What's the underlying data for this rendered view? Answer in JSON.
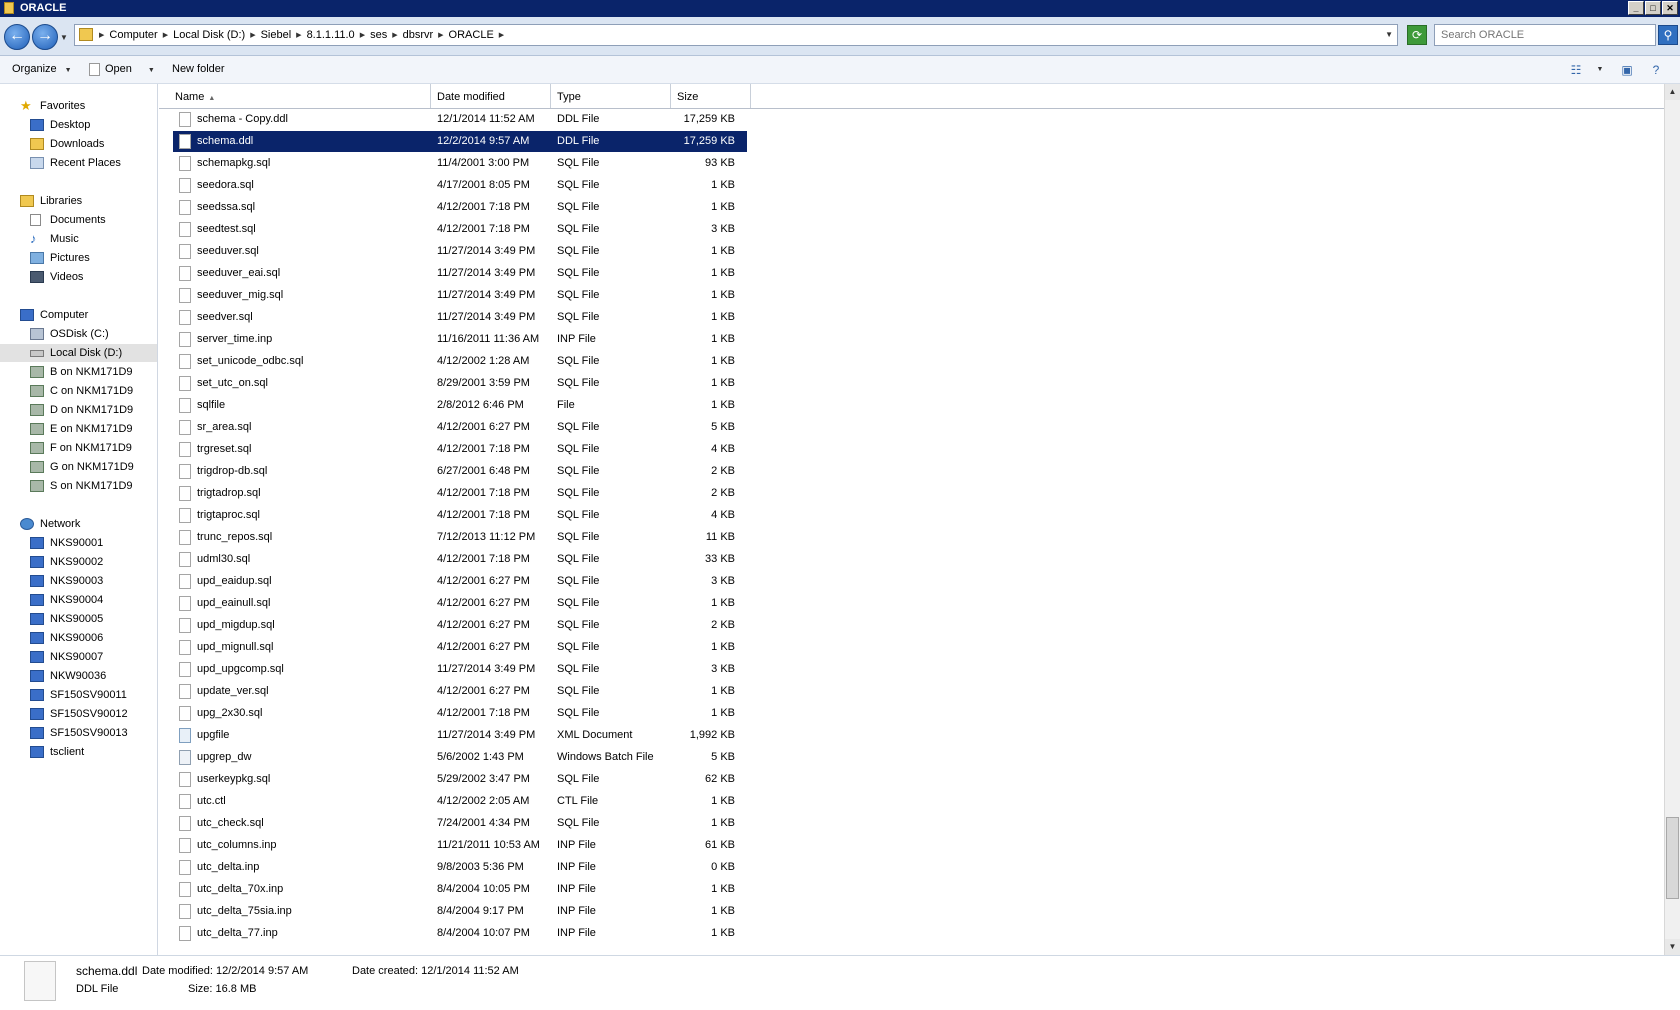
{
  "window": {
    "title": "ORACLE"
  },
  "address": {
    "crumbs": [
      "Computer",
      "Local Disk (D:)",
      "Siebel",
      "8.1.1.11.0",
      "ses",
      "dbsrvr",
      "ORACLE"
    ],
    "search_placeholder": "Search ORACLE"
  },
  "toolbar": {
    "organize": "Organize",
    "open": "Open",
    "new_folder": "New folder"
  },
  "nav": {
    "favorites": "Favorites",
    "desktop": "Desktop",
    "downloads": "Downloads",
    "recent_places": "Recent Places",
    "libraries": "Libraries",
    "documents": "Documents",
    "music": "Music",
    "pictures": "Pictures",
    "videos": "Videos",
    "computer": "Computer",
    "osdisk": "OSDisk (C:)",
    "localdisk": "Local Disk (D:)",
    "b_drive": "B on NKM171D9",
    "c_drive": "C on NKM171D9",
    "d_drive": "D on NKM171D9",
    "e_drive": "E on NKM171D9",
    "f_drive": "F on NKM171D9",
    "g_drive": "G on NKM171D9",
    "s_drive": "S on NKM171D9",
    "network": "Network",
    "net1": "NKS90001",
    "net2": "NKS90002",
    "net3": "NKS90003",
    "net4": "NKS90004",
    "net5": "NKS90005",
    "net6": "NKS90006",
    "net7": "NKS90007",
    "net8": "NKW90036",
    "net9": "SF150SV90011",
    "net10": "SF150SV90012",
    "net11": "SF150SV90013",
    "net12": "tsclient"
  },
  "columns": {
    "name": "Name",
    "date": "Date modified",
    "type": "Type",
    "size": "Size"
  },
  "files": [
    {
      "name": "schema - Copy.ddl",
      "date": "12/1/2014 11:52 AM",
      "type": "DDL File",
      "size": "17,259 KB"
    },
    {
      "name": "schema.ddl",
      "date": "12/2/2014 9:57 AM",
      "type": "DDL File",
      "size": "17,259 KB"
    },
    {
      "name": "schemapkg.sql",
      "date": "11/4/2001 3:00 PM",
      "type": "SQL File",
      "size": "93 KB"
    },
    {
      "name": "seedora.sql",
      "date": "4/17/2001 8:05 PM",
      "type": "SQL File",
      "size": "1 KB"
    },
    {
      "name": "seedssa.sql",
      "date": "4/12/2001 7:18 PM",
      "type": "SQL File",
      "size": "1 KB"
    },
    {
      "name": "seedtest.sql",
      "date": "4/12/2001 7:18 PM",
      "type": "SQL File",
      "size": "3 KB"
    },
    {
      "name": "seeduver.sql",
      "date": "11/27/2014 3:49 PM",
      "type": "SQL File",
      "size": "1 KB"
    },
    {
      "name": "seeduver_eai.sql",
      "date": "11/27/2014 3:49 PM",
      "type": "SQL File",
      "size": "1 KB"
    },
    {
      "name": "seeduver_mig.sql",
      "date": "11/27/2014 3:49 PM",
      "type": "SQL File",
      "size": "1 KB"
    },
    {
      "name": "seedver.sql",
      "date": "11/27/2014 3:49 PM",
      "type": "SQL File",
      "size": "1 KB"
    },
    {
      "name": "server_time.inp",
      "date": "11/16/2011 11:36 AM",
      "type": "INP File",
      "size": "1 KB"
    },
    {
      "name": "set_unicode_odbc.sql",
      "date": "4/12/2002 1:28 AM",
      "type": "SQL File",
      "size": "1 KB"
    },
    {
      "name": "set_utc_on.sql",
      "date": "8/29/2001 3:59 PM",
      "type": "SQL File",
      "size": "1 KB"
    },
    {
      "name": "sqlfile",
      "date": "2/8/2012 6:46 PM",
      "type": "File",
      "size": "1 KB"
    },
    {
      "name": "sr_area.sql",
      "date": "4/12/2001 6:27 PM",
      "type": "SQL File",
      "size": "5 KB"
    },
    {
      "name": "trgreset.sql",
      "date": "4/12/2001 7:18 PM",
      "type": "SQL File",
      "size": "4 KB"
    },
    {
      "name": "trigdrop-db.sql",
      "date": "6/27/2001 6:48 PM",
      "type": "SQL File",
      "size": "2 KB"
    },
    {
      "name": "trigtadrop.sql",
      "date": "4/12/2001 7:18 PM",
      "type": "SQL File",
      "size": "2 KB"
    },
    {
      "name": "trigtaproc.sql",
      "date": "4/12/2001 7:18 PM",
      "type": "SQL File",
      "size": "4 KB"
    },
    {
      "name": "trunc_repos.sql",
      "date": "7/12/2013 11:12 PM",
      "type": "SQL File",
      "size": "11 KB"
    },
    {
      "name": "udml30.sql",
      "date": "4/12/2001 7:18 PM",
      "type": "SQL File",
      "size": "33 KB"
    },
    {
      "name": "upd_eaidup.sql",
      "date": "4/12/2001 6:27 PM",
      "type": "SQL File",
      "size": "3 KB"
    },
    {
      "name": "upd_eainull.sql",
      "date": "4/12/2001 6:27 PM",
      "type": "SQL File",
      "size": "1 KB"
    },
    {
      "name": "upd_migdup.sql",
      "date": "4/12/2001 6:27 PM",
      "type": "SQL File",
      "size": "2 KB"
    },
    {
      "name": "upd_mignull.sql",
      "date": "4/12/2001 6:27 PM",
      "type": "SQL File",
      "size": "1 KB"
    },
    {
      "name": "upd_upgcomp.sql",
      "date": "11/27/2014 3:49 PM",
      "type": "SQL File",
      "size": "3 KB"
    },
    {
      "name": "update_ver.sql",
      "date": "4/12/2001 6:27 PM",
      "type": "SQL File",
      "size": "1 KB"
    },
    {
      "name": "upg_2x30.sql",
      "date": "4/12/2001 7:18 PM",
      "type": "SQL File",
      "size": "1 KB"
    },
    {
      "name": "upgfile",
      "date": "11/27/2014 3:49 PM",
      "type": "XML Document",
      "size": "1,992 KB"
    },
    {
      "name": "upgrep_dw",
      "date": "5/6/2002 1:43 PM",
      "type": "Windows Batch File",
      "size": "5 KB"
    },
    {
      "name": "userkeypkg.sql",
      "date": "5/29/2002 3:47 PM",
      "type": "SQL File",
      "size": "62 KB"
    },
    {
      "name": "utc.ctl",
      "date": "4/12/2002 2:05 AM",
      "type": "CTL File",
      "size": "1 KB"
    },
    {
      "name": "utc_check.sql",
      "date": "7/24/2001 4:34 PM",
      "type": "SQL File",
      "size": "1 KB"
    },
    {
      "name": "utc_columns.inp",
      "date": "11/21/2011 10:53 AM",
      "type": "INP File",
      "size": "61 KB"
    },
    {
      "name": "utc_delta.inp",
      "date": "9/8/2003 5:36 PM",
      "type": "INP File",
      "size": "0 KB"
    },
    {
      "name": "utc_delta_70x.inp",
      "date": "8/4/2004 10:05 PM",
      "type": "INP File",
      "size": "1 KB"
    },
    {
      "name": "utc_delta_75sia.inp",
      "date": "8/4/2004 9:17 PM",
      "type": "INP File",
      "size": "1 KB"
    },
    {
      "name": "utc_delta_77.inp",
      "date": "8/4/2004 10:07 PM",
      "type": "INP File",
      "size": "1 KB"
    }
  ],
  "details": {
    "name": "schema.ddl",
    "type": "DDL File",
    "date_modified": "Date modified: 12/2/2014 9:57 AM",
    "date_created": "Date created: 12/1/2014 11:52 AM",
    "size": "Size: 16.8 MB"
  }
}
